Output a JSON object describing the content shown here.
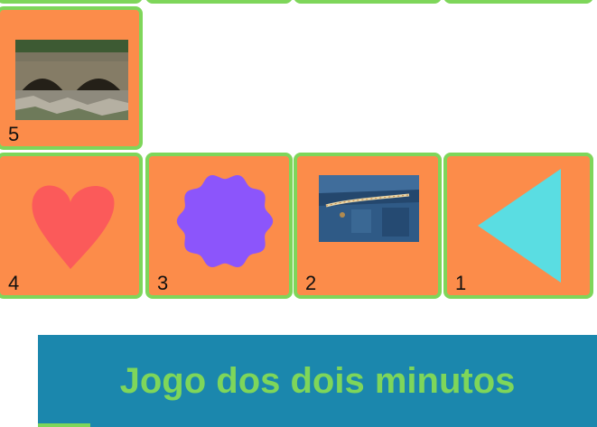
{
  "game": {
    "title": "Jogo dos dois minutos",
    "cards": [
      {
        "number": "5",
        "content": "photo-stone-bridge"
      },
      {
        "number": "4",
        "content": "heart-shape"
      },
      {
        "number": "3",
        "content": "wavy-circle-shape"
      },
      {
        "number": "2",
        "content": "photo-jeans-with-measuring-tape"
      },
      {
        "number": "1",
        "content": "left-triangle-shape"
      }
    ]
  },
  "colors": {
    "card_bg": "#fc8c4a",
    "card_border": "#7ed65a",
    "banner_bg": "#1b87ad",
    "title_text": "#7ed65a",
    "heart": "#fb5a5a",
    "blob": "#8c55fb",
    "triangle": "#5adde2"
  }
}
